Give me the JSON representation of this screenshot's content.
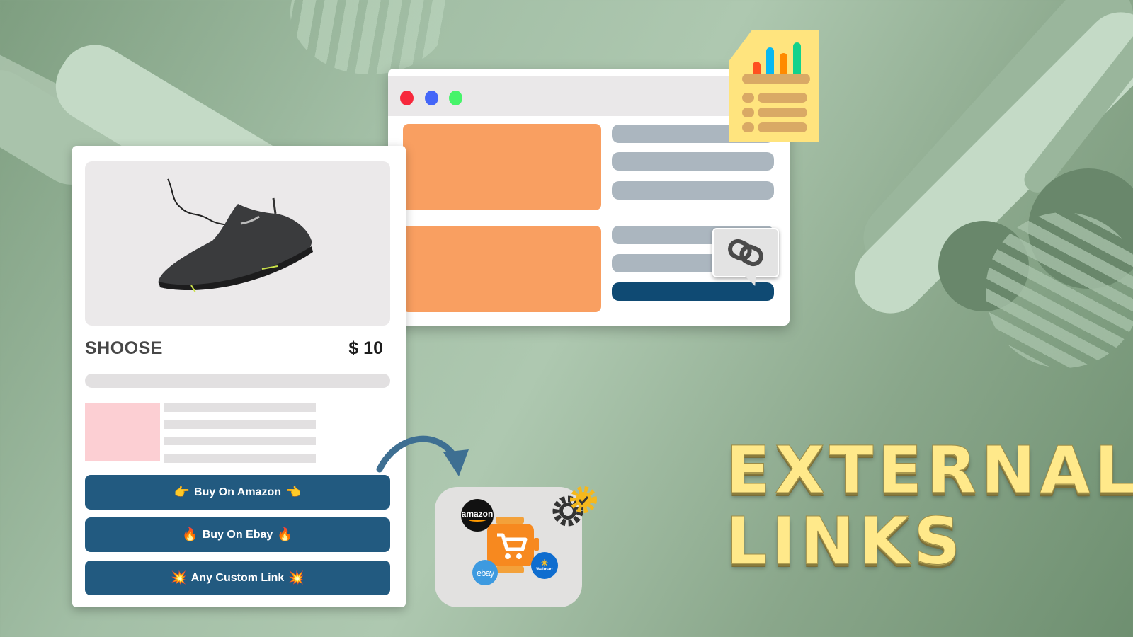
{
  "background": {
    "decorations": [
      "diagonal-bars",
      "striped-circles"
    ]
  },
  "browser_window": {
    "traffic_lights": [
      {
        "name": "red",
        "color": "#f7283c"
      },
      {
        "name": "blue",
        "color": "#4466f8"
      },
      {
        "name": "green",
        "color": "#46f46a"
      }
    ],
    "accent_block_color": "#f99f61",
    "placeholder_line_color": "#abb6bf",
    "active_line_color": "#0f4a73"
  },
  "icons": {
    "report": "report-document-icon",
    "link": "chain-link-icon",
    "gear": "gear-check-icon",
    "cart": "shopping-cart-icon",
    "arrow": "curved-arrow-icon"
  },
  "report_bars": [
    {
      "value": 0.35,
      "color": "#ff5020"
    },
    {
      "value": 0.75,
      "color": "#08b8f2"
    },
    {
      "value": 0.6,
      "color": "#ff8a00"
    },
    {
      "value": 0.9,
      "color": "#12d28c"
    }
  ],
  "product": {
    "image_alt": "Black running shoe",
    "name": "SHOOSE",
    "price": "$ 10",
    "buttons": [
      {
        "emoji_left": "👉",
        "label": "Buy On Amazon",
        "emoji_right": "👈"
      },
      {
        "emoji_left": "🔥",
        "label": "Buy On Ebay",
        "emoji_right": "🔥"
      },
      {
        "emoji_left": "💥",
        "label": "Any Custom Link",
        "emoji_right": "💥"
      }
    ],
    "button_color": "#225a80"
  },
  "marketplaces": {
    "logos": [
      "amazon",
      "ebay",
      "Walmart"
    ],
    "amazon_label": "amazon",
    "ebay_label": "ebay",
    "walmart_label": "Walmart"
  },
  "headline": {
    "line1": "EXTERNAL",
    "line2": "LINKS",
    "color": "#ffe98a"
  }
}
